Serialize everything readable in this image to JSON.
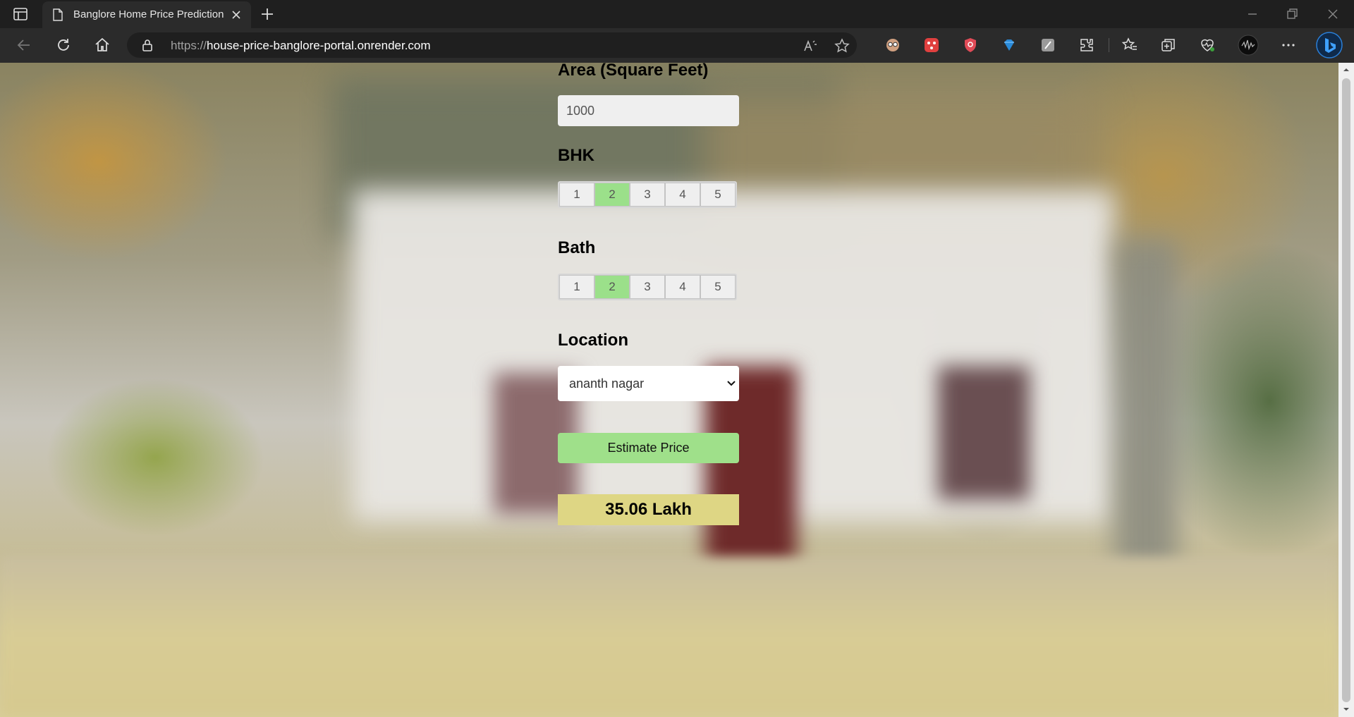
{
  "browser": {
    "tab_title": "Banglore Home Price Prediction",
    "url_protocol": "https://",
    "url_host": "house-price-banglore-portal.onrender.com"
  },
  "form": {
    "area_label": "Area (Square Feet)",
    "area_value": "1000",
    "bhk_label": "BHK",
    "bhk_options": [
      "1",
      "2",
      "3",
      "4",
      "5"
    ],
    "bhk_selected": "2",
    "bath_label": "Bath",
    "bath_options": [
      "1",
      "2",
      "3",
      "4",
      "5"
    ],
    "bath_selected": "2",
    "location_label": "Location",
    "location_selected": "ananth nagar",
    "estimate_button": "Estimate Price",
    "result": "35.06 Lakh"
  },
  "colors": {
    "selected_option": "#9be08a",
    "button": "#9fe08a",
    "result_bg": "#ded684"
  }
}
